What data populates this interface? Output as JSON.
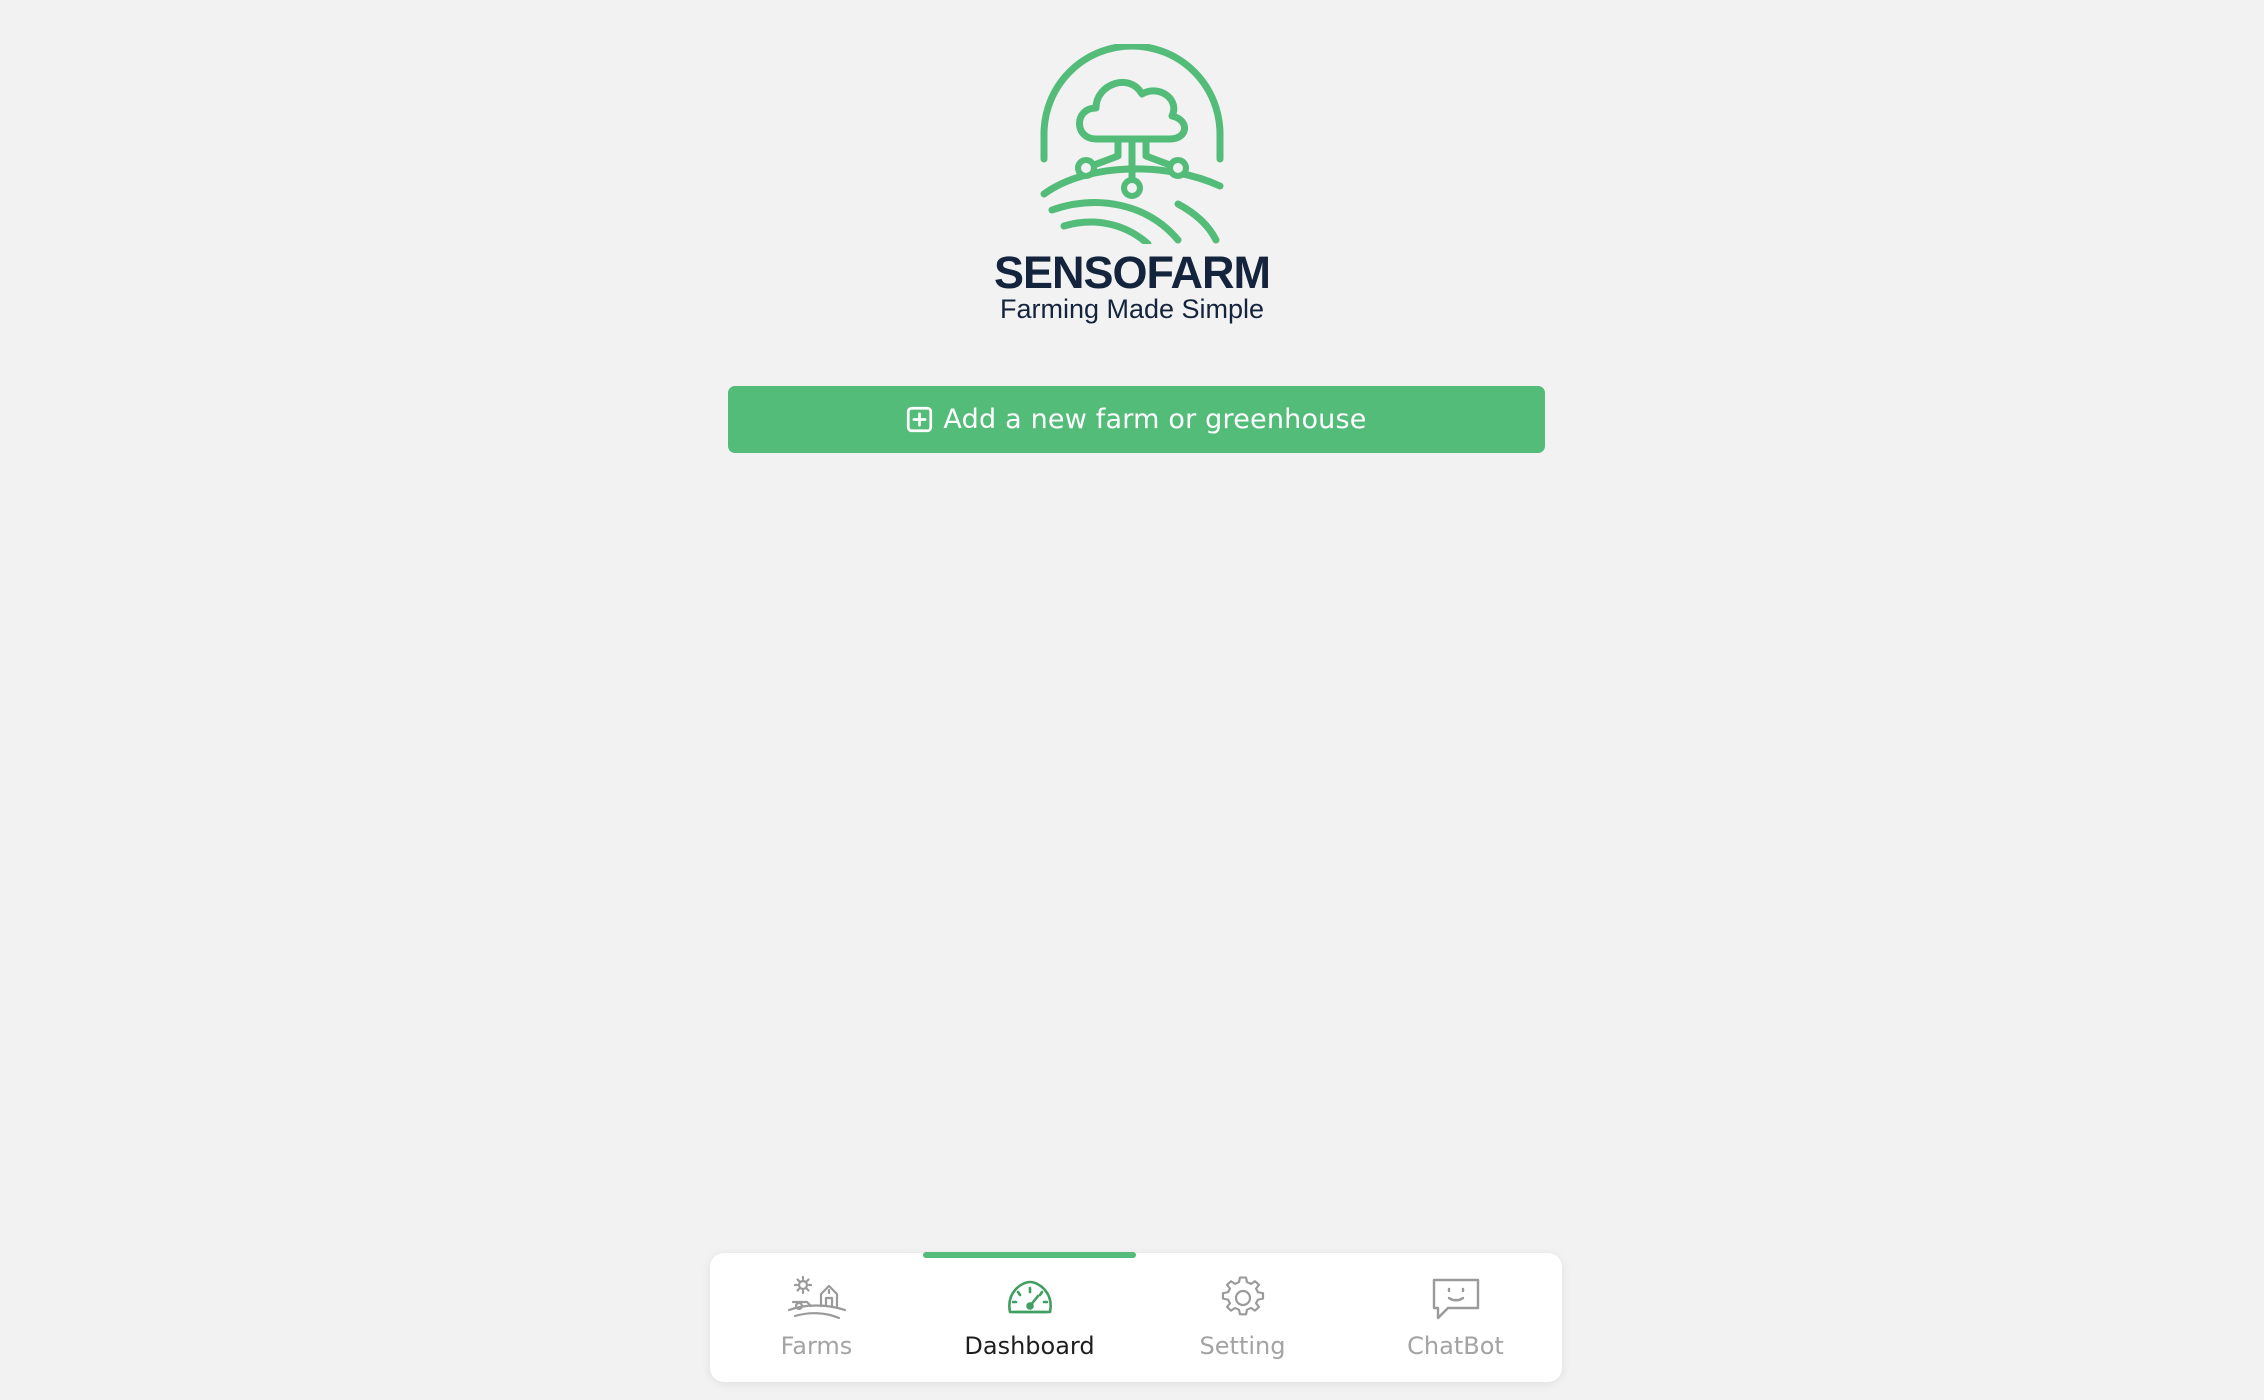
{
  "brand": {
    "name": "SENSOFARM",
    "tagline": "Farming Made Simple"
  },
  "actions": {
    "add_farm_label": "Add a new farm or greenhouse"
  },
  "bottom_nav": {
    "items": [
      {
        "label": "Farms",
        "icon": "farm-icon",
        "active": false
      },
      {
        "label": "Dashboard",
        "icon": "dashboard-gauge-icon",
        "active": true
      },
      {
        "label": "Setting",
        "icon": "gear-icon",
        "active": false
      },
      {
        "label": "ChatBot",
        "icon": "chat-bubble-icon",
        "active": false
      }
    ]
  },
  "colors": {
    "accent": "#54bc79",
    "brand_text": "#14243c",
    "background": "#f2f2f2",
    "inactive_nav": "#a3a3a3"
  }
}
